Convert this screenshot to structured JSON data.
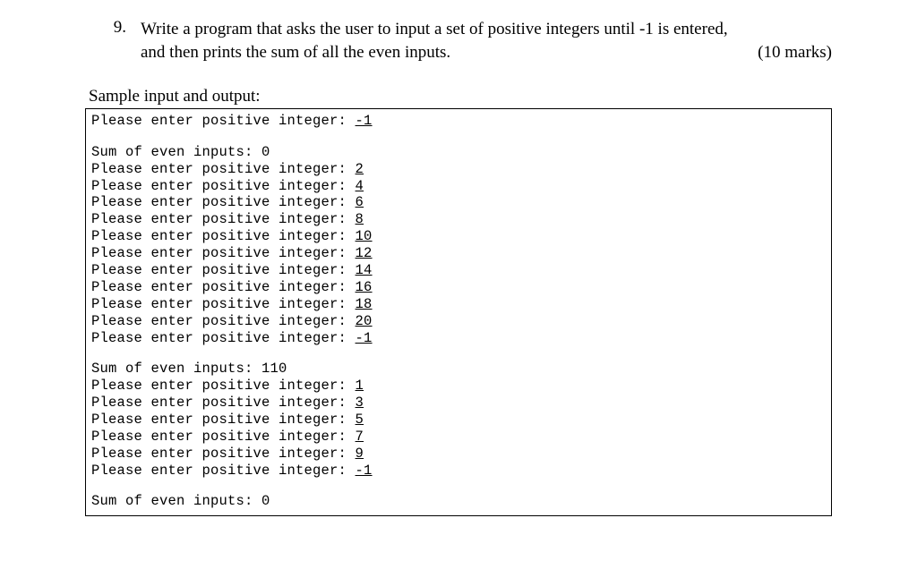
{
  "question": {
    "number": "9.",
    "line1": "Write a program that asks the user to input a set of positive integers until -1 is entered,",
    "line2": "and then prints the sum of all the even inputs.",
    "marks": "(10 marks)"
  },
  "sample_label": "Sample input and output:",
  "prompt_text": "Please enter positive integer: ",
  "sum_text": "Sum of even inputs: ",
  "runs": [
    {
      "inputs": [
        "-1"
      ],
      "sum": "0"
    },
    {
      "inputs": [
        "2",
        "4",
        "6",
        "8",
        "10",
        "12",
        "14",
        "16",
        "18",
        "20",
        "-1"
      ],
      "sum": "110"
    },
    {
      "inputs": [
        "1",
        "3",
        "5",
        "7",
        "9",
        "-1"
      ],
      "sum": "0"
    }
  ]
}
